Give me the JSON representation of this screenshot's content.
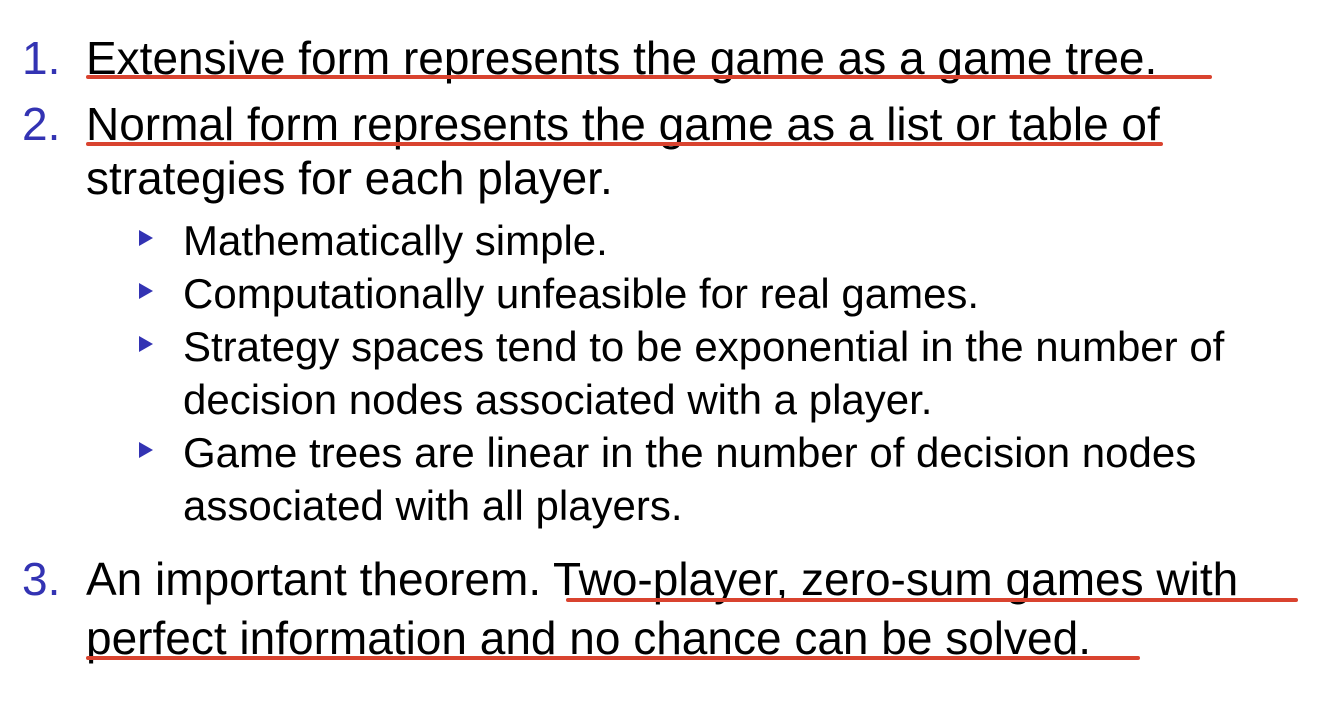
{
  "colors": {
    "number": "#3333b3",
    "text": "#000000",
    "underline": "#d9432f",
    "bullet": "#3333b3"
  },
  "items": [
    {
      "number": "1.",
      "lines": [
        "Extensive form represents the game as a game tree."
      ]
    },
    {
      "number": "2.",
      "line1_underlined": "Normal form represents the game as a list or table",
      "line1_rest": " of",
      "line2": "strategies for each player.",
      "bullets": [
        {
          "lines": [
            "Mathematically simple."
          ]
        },
        {
          "lines": [
            "Computationally unfeasible for real games."
          ]
        },
        {
          "lines": [
            "Strategy spaces tend to be exponential in the number of",
            "decision nodes associated with a player."
          ]
        },
        {
          "lines": [
            "Game trees are linear in the number of decision nodes",
            "associated with all players."
          ]
        }
      ]
    },
    {
      "number": "3.",
      "line1_plain": "An important theorem.",
      "line1_underlined": " Two-player, zero-sum games with",
      "line2": "perfect information and no chance can be solved."
    }
  ],
  "bullet_icon": "blue-triangle-bullet-icon"
}
